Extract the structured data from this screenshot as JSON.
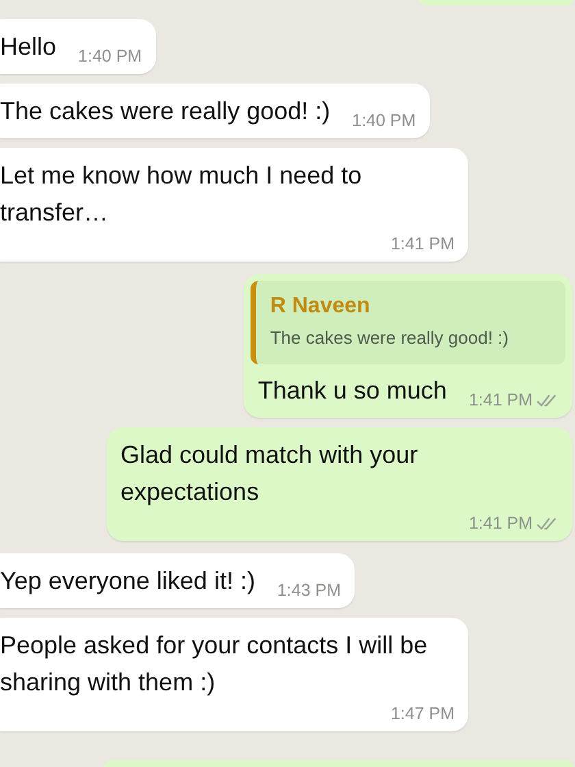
{
  "messages": [
    {
      "kind": "incoming",
      "text": "Hello",
      "time": "1:40 PM"
    },
    {
      "kind": "incoming",
      "text": "The cakes were really good! :)",
      "time": "1:40 PM"
    },
    {
      "kind": "incoming",
      "text": "Let me know how much I need to transfer…",
      "time": "1:41 PM"
    },
    {
      "kind": "outgoing",
      "quote": {
        "author": "R Naveen",
        "text": "The cakes were really good! :)"
      },
      "text": "Thank u so much",
      "time": "1:41 PM",
      "read": false
    },
    {
      "kind": "outgoing",
      "text": "Glad could match with your expectations",
      "time": "1:41 PM",
      "read": false
    },
    {
      "kind": "incoming",
      "text": "Yep everyone liked it! :)",
      "time": "1:43 PM"
    },
    {
      "kind": "incoming",
      "text": "People asked for your contacts I will be sharing with them :)",
      "time": "1:47 PM"
    }
  ]
}
